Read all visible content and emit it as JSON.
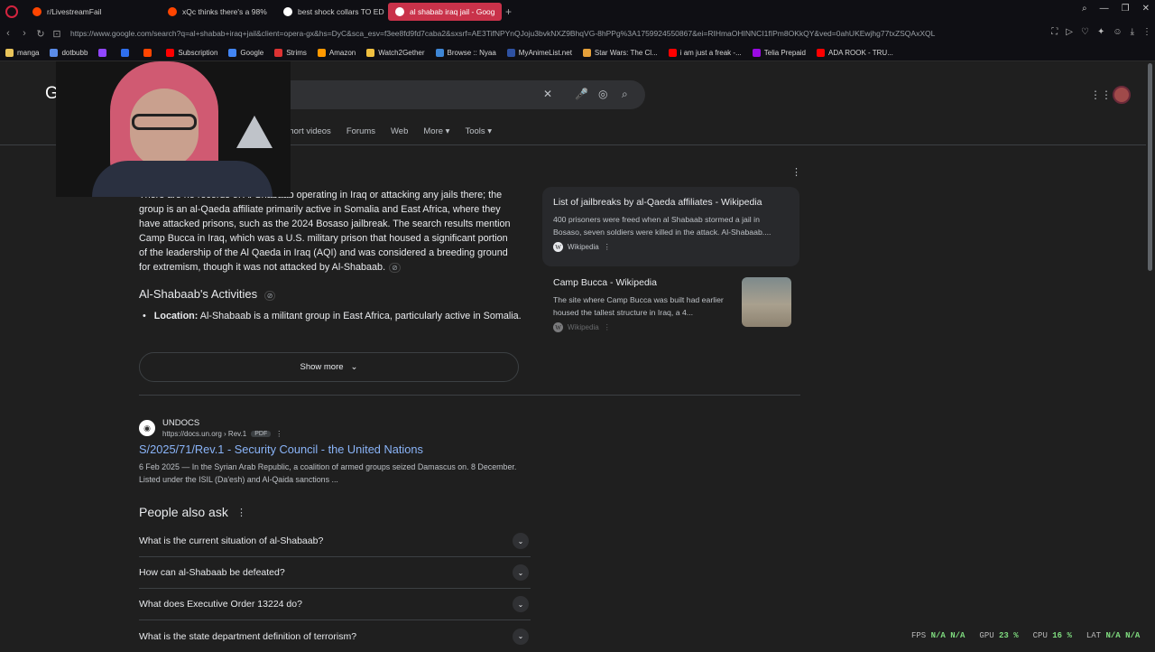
{
  "tabs": [
    {
      "label": "r/LivestreamFail",
      "color": "#ff4500",
      "active": false
    },
    {
      "label": "xQc thinks there's a 98%",
      "color": "#ff4500",
      "active": false
    },
    {
      "label": "best shock collars TO ED",
      "color": "#ffffff",
      "active": false
    },
    {
      "label": "al shabab iraq jail - Goog",
      "color": "#ffffff",
      "active": true
    }
  ],
  "url": "https://www.google.com/search?q=al+shabab+iraq+jail&client=opera-gx&hs=DyC&sca_esv=f3ee8fd9fd7caba2&sxsrf=AE3TifNPYnQJoju3bvkNXZ9BhqVG-8hPPg%3A1759924550867&ei=RIHmaOHINNCI1fIPm8OKkQY&ved=0ahUKEwjhg77txZSQAxXQL",
  "bookmarks": [
    {
      "label": "manga",
      "color": "#e8c35a"
    },
    {
      "label": "dotbubb",
      "color": "#5a8be8"
    },
    {
      "label": "",
      "color": "#9146ff"
    },
    {
      "label": "",
      "color": "#2f6fed"
    },
    {
      "label": "",
      "color": "#ff4500"
    },
    {
      "label": "Subscription",
      "color": "#ff0000"
    },
    {
      "label": "Google",
      "color": "#4285f4"
    },
    {
      "label": "Strims",
      "color": "#d33"
    },
    {
      "label": "Amazon",
      "color": "#ff9900"
    },
    {
      "label": "Watch2Gether",
      "color": "#f0c040"
    },
    {
      "label": "Browse :: Nyaa",
      "color": "#3e86d6"
    },
    {
      "label": "MyAnimeList.net",
      "color": "#2e51a2"
    },
    {
      "label": "Star Wars: The Cl...",
      "color": "#e5a03a"
    },
    {
      "label": "i am just a freak -...",
      "color": "#ff0000"
    },
    {
      "label": "Telia Prepaid",
      "color": "#990ae3"
    },
    {
      "label": "ADA ROOK - TRU...",
      "color": "#ff0000"
    }
  ],
  "header": {
    "logo": "Google",
    "nav_tabs": [
      "Short videos",
      "Forums",
      "Web",
      "More ▾",
      "Tools ▾"
    ]
  },
  "ai_overview": {
    "paragraph_partial": "There are no records of Al-Shabaab operating in Iraq or attacking any jails there; the group is an al-Qaeda affiliate primarily active in Somalia and East Africa, where they have attacked prisons, such as the 2024 Bosaso jailbreak. The search results mention Camp Bucca in Iraq, which was a U.S. military prison that housed a significant portion of the leadership of the Al Qaeda in Iraq (AQI) and was considered a breeding ground for extremism, though it was not attacked by Al-Shabaab.",
    "section_heading": "Al-Shabaab's Activities",
    "bullet_label": "Location:",
    "bullet_text": " Al-Shabaab is a militant group in East Africa, particularly active in Somalia.",
    "show_more": "Show more",
    "sources": [
      {
        "title": "List of jailbreaks by al-Qaeda affiliates - Wikipedia",
        "snippet": "400 prisoners were freed when al Shabaab stormed a jail in Bosaso, seven soldiers were killed in the attack. Al-Shabaab....",
        "site": "Wikipedia"
      },
      {
        "title": "Camp Bucca - Wikipedia",
        "snippet": "The site where Camp Bucca was built had earlier housed the tallest structure in Iraq, a 4...",
        "site": "Wikipedia"
      }
    ]
  },
  "result": {
    "site_name": "UNDOCS",
    "url": "https://docs.un.org › Rev.1",
    "badge": "PDF",
    "title": "S/2025/71/Rev.1 - Security Council - the United Nations",
    "snippet": "6 Feb 2025 — In the Syrian Arab Republic, a coalition of armed groups seized Damascus on. 8 December. Listed under the ISIL (Da'esh) and Al-Qaida sanctions ..."
  },
  "people_also_ask": {
    "heading": "People also ask",
    "questions": [
      "What is the current situation of al-Shabaab?",
      "How can al-Shabaab be defeated?",
      "What does Executive Order 13224 do?",
      "What is the state department definition of terrorism?"
    ]
  },
  "stats": {
    "fps_label": "FPS",
    "fps_val1": "N/A",
    "fps_val2": "N/A",
    "gpu_label": "GPU",
    "gpu_val": "23 %",
    "cpu_label": "CPU",
    "cpu_val": "16 %",
    "lat_label": "LAT",
    "lat_val1": "N/A",
    "lat_val2": "N/A"
  }
}
